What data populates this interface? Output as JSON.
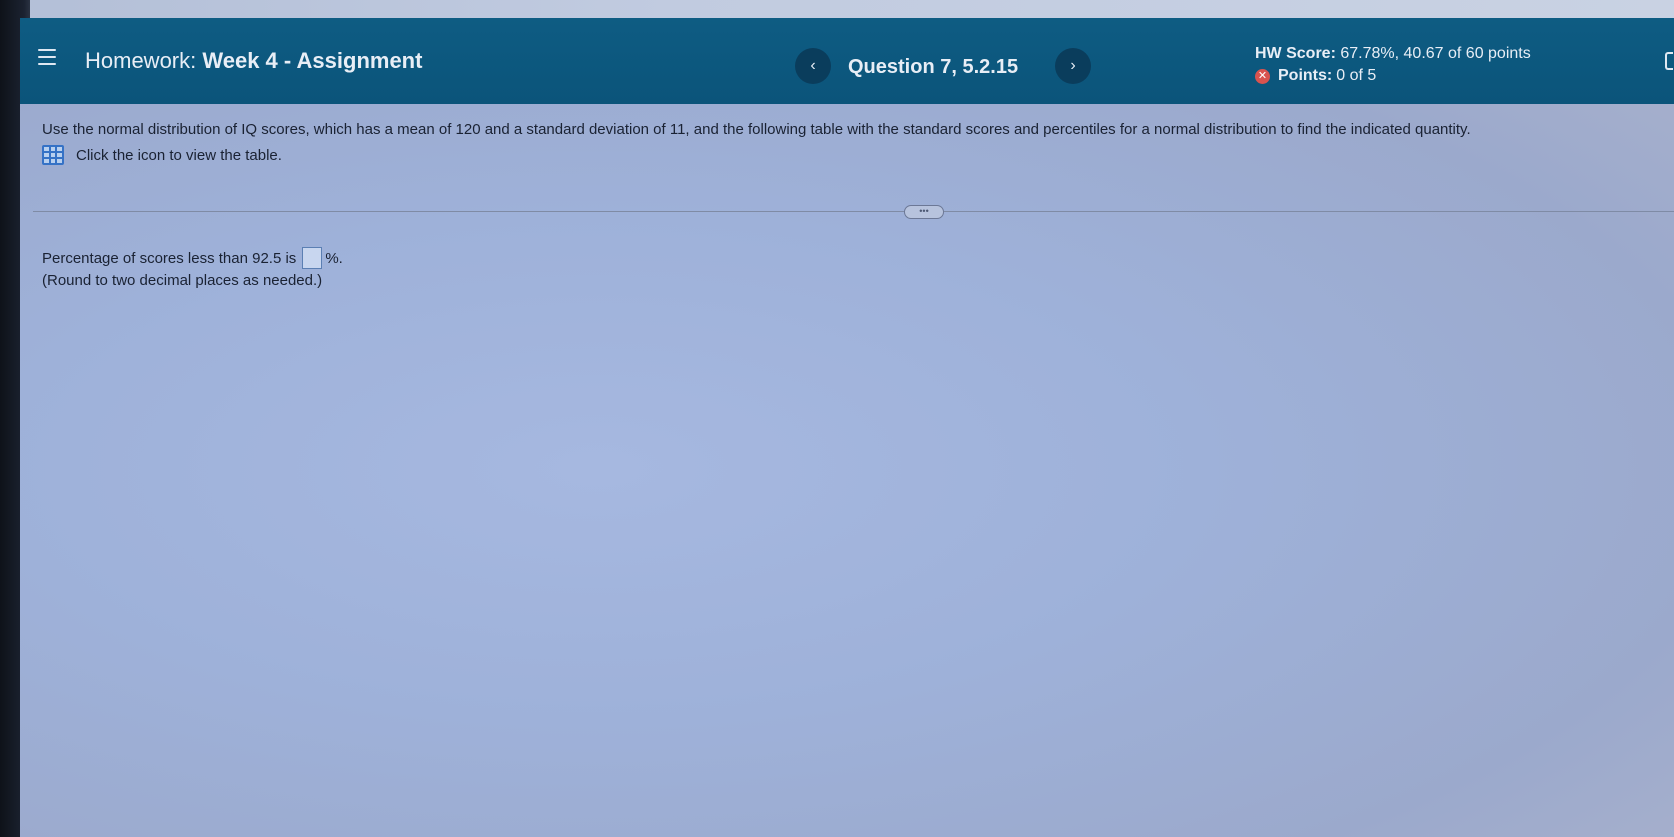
{
  "header": {
    "menu_icon": "hamburger-menu-icon",
    "title_label": "Homework:",
    "title_value": "Week 4 - Assignment",
    "question_label": "Question 7, 5.2.15",
    "prev_symbol": "‹",
    "next_symbol": "›",
    "hw_score_label": "HW Score:",
    "hw_score_value": "67.78%, 40.67 of 60 points",
    "points_label": "Points:",
    "points_value": "0 of 5",
    "points_status_icon": "incorrect-x-icon"
  },
  "question": {
    "text": "Use the normal distribution of IQ scores, which has a mean of 120 and a standard deviation of 11, and the following table with the standard scores and percentiles for a normal distribution to find the indicated quantity.",
    "table_link_text": "Click the icon to view the table.",
    "table_icon": "table-grid-icon"
  },
  "divider": {
    "handle_text": "•••"
  },
  "answer": {
    "prefix": "Percentage of scores less than 92.5 is",
    "value": "",
    "suffix": "%.",
    "note": "(Round to two decimal places as needed.)"
  },
  "colors": {
    "header_bg": "#0b547a",
    "content_bg": "#a3b6de",
    "accent_blue": "#3572c6",
    "error_red": "#d9534f"
  }
}
